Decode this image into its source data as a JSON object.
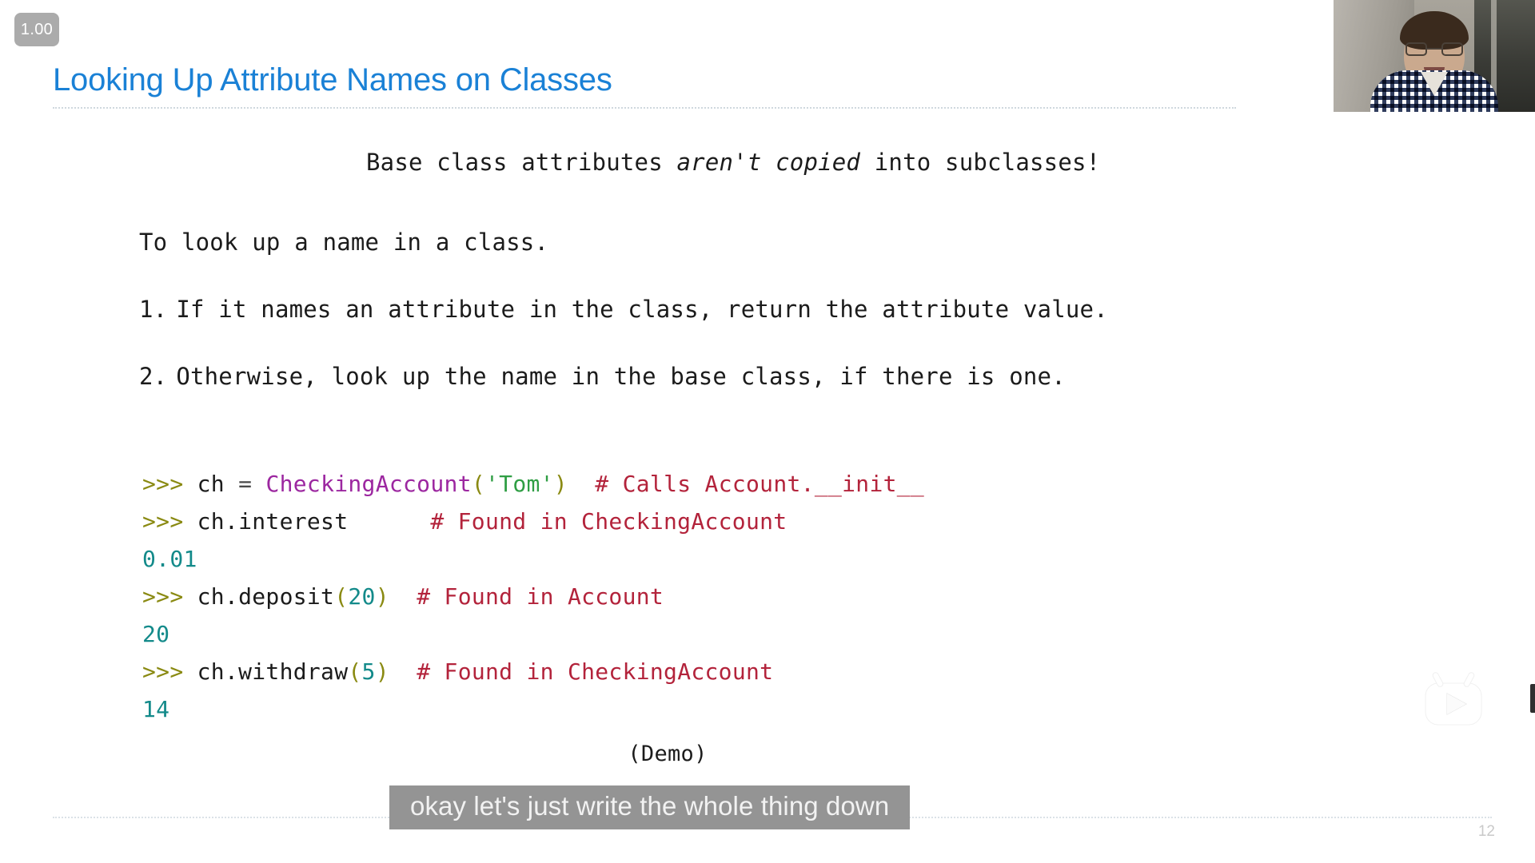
{
  "player": {
    "speed_badge": "1.00",
    "logo_icon": "tv-play-icon",
    "caption": "okay let's just write the whole thing down"
  },
  "slide": {
    "title": "Looking Up Attribute Names on Classes",
    "page_number": "12",
    "subtitle": {
      "before": "Base class attributes ",
      "emphasis": "aren't copied",
      "after": " into subclasses!"
    },
    "lead": "To look up a name in a class.",
    "steps": [
      {
        "num": "1.",
        "text": "If it names an attribute in the class, return the attribute value."
      },
      {
        "num": "2.",
        "text": "Otherwise, look up the name in the base class, if there is one."
      }
    ],
    "demo_label": "(Demo)",
    "code_lines": [
      [
        {
          "t": ">>> ",
          "c": "tok-prompt"
        },
        {
          "t": "ch ",
          "c": "tok-plain"
        },
        {
          "t": "= ",
          "c": "tok-op"
        },
        {
          "t": "CheckingAccount",
          "c": "tok-class"
        },
        {
          "t": "(",
          "c": "tok-paren"
        },
        {
          "t": "'Tom'",
          "c": "tok-string"
        },
        {
          "t": ")",
          "c": "tok-paren"
        },
        {
          "t": "  ",
          "c": "tok-plain"
        },
        {
          "t": "# Calls Account.__init__",
          "c": "tok-comment"
        }
      ],
      [
        {
          "t": ">>> ",
          "c": "tok-prompt"
        },
        {
          "t": "ch.interest",
          "c": "tok-plain"
        },
        {
          "t": "      ",
          "c": "tok-plain"
        },
        {
          "t": "# Found in CheckingAccount",
          "c": "tok-comment"
        }
      ],
      [
        {
          "t": "0.01",
          "c": "tok-out"
        }
      ],
      [
        {
          "t": ">>> ",
          "c": "tok-prompt"
        },
        {
          "t": "ch.deposit",
          "c": "tok-plain"
        },
        {
          "t": "(",
          "c": "tok-paren"
        },
        {
          "t": "20",
          "c": "tok-number"
        },
        {
          "t": ")",
          "c": "tok-paren"
        },
        {
          "t": "  ",
          "c": "tok-plain"
        },
        {
          "t": "# Found in Account",
          "c": "tok-comment"
        }
      ],
      [
        {
          "t": "20",
          "c": "tok-out"
        }
      ],
      [
        {
          "t": ">>> ",
          "c": "tok-prompt"
        },
        {
          "t": "ch.withdraw",
          "c": "tok-plain"
        },
        {
          "t": "(",
          "c": "tok-paren"
        },
        {
          "t": "5",
          "c": "tok-number"
        },
        {
          "t": ")",
          "c": "tok-paren"
        },
        {
          "t": "  ",
          "c": "tok-plain"
        },
        {
          "t": "# Found in CheckingAccount",
          "c": "tok-comment"
        }
      ],
      [
        {
          "t": "14",
          "c": "tok-out"
        }
      ]
    ]
  },
  "colors": {
    "title_blue": "#1a81d6",
    "comment_red": "#b3233b",
    "class_purple": "#9c27a0",
    "string_green": "#2f9e44",
    "output_teal": "#138a8a",
    "prompt_olive": "#8a8a12",
    "caption_bg": "#949494",
    "badge_bg": "#ababab"
  }
}
